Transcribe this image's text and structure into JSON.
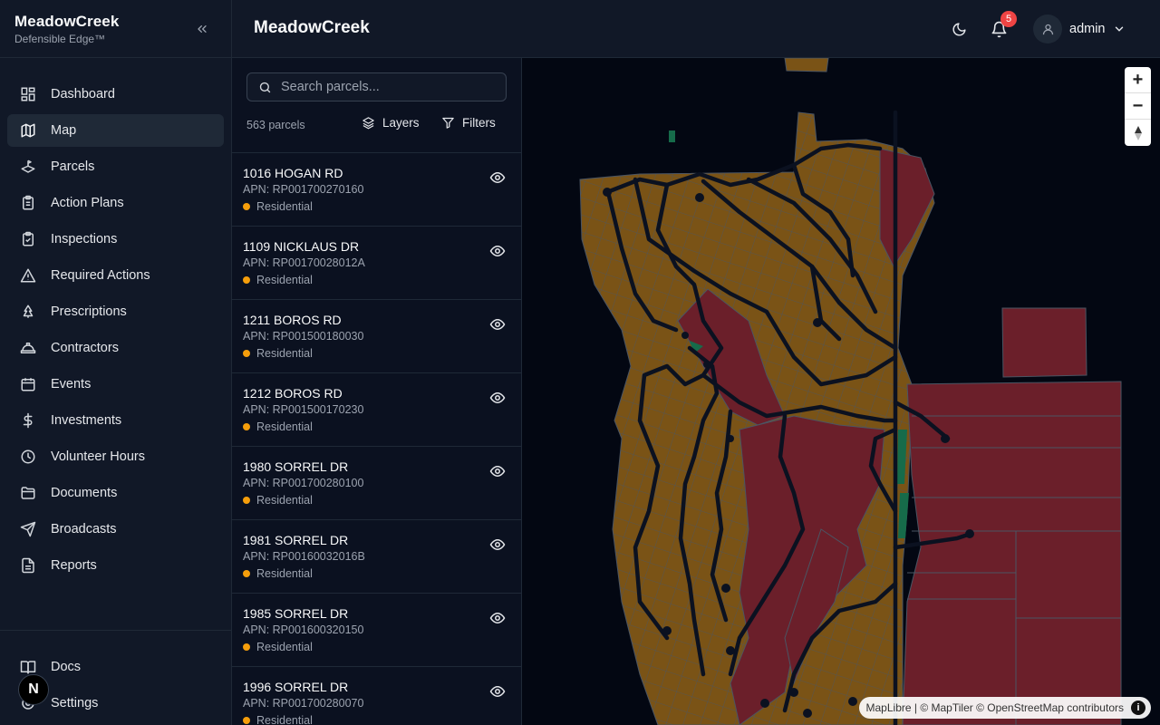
{
  "brand": {
    "title": "MeadowCreek",
    "subtitle": "Defensible Edge™"
  },
  "sidebar": {
    "items": [
      {
        "label": "Dashboard",
        "icon": "dashboard-icon"
      },
      {
        "label": "Map",
        "icon": "map-icon",
        "active": true
      },
      {
        "label": "Parcels",
        "icon": "parcels-icon"
      },
      {
        "label": "Action Plans",
        "icon": "clipboard-list-icon"
      },
      {
        "label": "Inspections",
        "icon": "clipboard-check-icon"
      },
      {
        "label": "Required Actions",
        "icon": "warning-icon"
      },
      {
        "label": "Prescriptions",
        "icon": "tree-icon"
      },
      {
        "label": "Contractors",
        "icon": "hard-hat-icon"
      },
      {
        "label": "Events",
        "icon": "calendar-icon"
      },
      {
        "label": "Investments",
        "icon": "dollar-icon"
      },
      {
        "label": "Volunteer Hours",
        "icon": "clock-icon"
      },
      {
        "label": "Documents",
        "icon": "folder-icon"
      },
      {
        "label": "Broadcasts",
        "icon": "send-icon"
      },
      {
        "label": "Reports",
        "icon": "file-text-icon"
      }
    ],
    "footer": [
      {
        "label": "Docs",
        "icon": "book-icon"
      },
      {
        "label": "Settings",
        "icon": "gear-icon"
      }
    ],
    "avatar_letter": "N"
  },
  "header": {
    "title": "MeadowCreek",
    "notification_count": "5",
    "user": "admin"
  },
  "panel": {
    "search_placeholder": "Search parcels...",
    "count": "563 parcels",
    "layers_label": "Layers",
    "filters_label": "Filters",
    "parcels": [
      {
        "address": "1016 HOGAN RD",
        "apn": "APN: RP001700270160",
        "type": "Residential"
      },
      {
        "address": "1109 NICKLAUS DR",
        "apn": "APN: RP00170028012A",
        "type": "Residential"
      },
      {
        "address": "1211 BOROS RD",
        "apn": "APN: RP001500180030",
        "type": "Residential"
      },
      {
        "address": "1212 BOROS RD",
        "apn": "APN: RP001500170230",
        "type": "Residential"
      },
      {
        "address": "1980 SORREL DR",
        "apn": "APN: RP001700280100",
        "type": "Residential"
      },
      {
        "address": "1981 SORREL DR",
        "apn": "APN: RP00160032016B",
        "type": "Residential"
      },
      {
        "address": "1985 SORREL DR",
        "apn": "APN: RP001600320150",
        "type": "Residential"
      },
      {
        "address": "1996 SORREL DR",
        "apn": "APN: RP001700280070",
        "type": "Residential"
      }
    ]
  },
  "map": {
    "attribution": "MapLibre | © MapTiler © OpenStreetMap contributors",
    "zoom_in": "+",
    "zoom_out": "−",
    "colors": {
      "residential": "#7a5316",
      "common": "#6b1f2a",
      "green": "#166b4a",
      "road": "#0b1120"
    }
  }
}
